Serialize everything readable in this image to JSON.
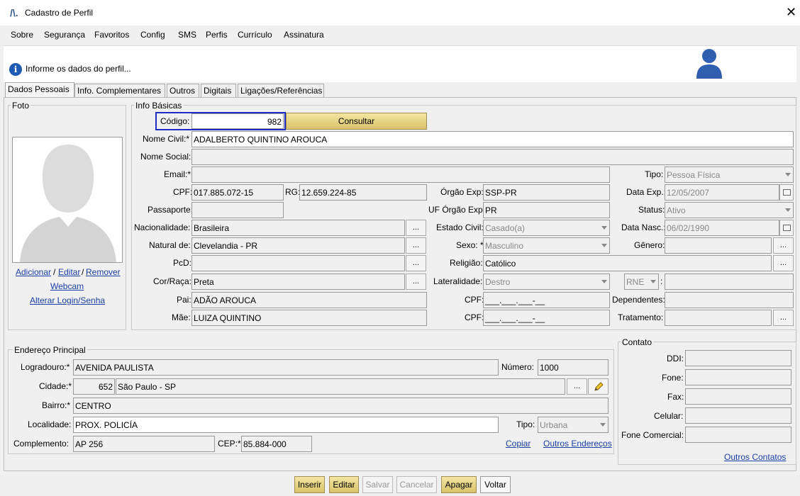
{
  "window": {
    "title": "Cadastro de Perfil",
    "close": "✕",
    "logo": "/\\."
  },
  "menu": [
    "Sobre",
    "Segurança",
    "Favoritos",
    "Config",
    "SMS",
    "Perfis",
    "Currículo",
    "Assinatura"
  ],
  "info": {
    "text": "Informe os dados do perfil...",
    "icon": "i"
  },
  "tabs": [
    "Dados Pessoais",
    "Info. Complementares",
    "Outros",
    "Digitais",
    "Ligações/Referências"
  ],
  "foto": {
    "legend": "Foto",
    "adicionar": "Adicionar",
    "sep1": "/",
    "editar": "Editar",
    "sep2": "/",
    "remover": "Remover",
    "webcam": "Webcam",
    "alterar": "Alterar Login/Senha"
  },
  "info_basicas": {
    "legend": "Info Básicas",
    "codigo_label": "Código:",
    "codigo": "982",
    "consultar": "Consultar",
    "nome_civil_label": "Nome Civil:*",
    "nome_civil": "ADALBERTO QUINTINO AROUCA",
    "nome_social_label": "Nome Social:",
    "nome_social": "",
    "email_label": "Email:*",
    "email": "",
    "tipo_label": "Tipo:",
    "tipo": "Pessoa Física",
    "cpf_label": "CPF:",
    "cpf": "017.885.072-15",
    "rg_label": "RG:",
    "rg": "12.659.224-85",
    "orgao_exp_label": "Órgão Exp:",
    "orgao_exp": "SSP-PR",
    "data_exp_label": "Data Exp.:",
    "data_exp": "12/05/2007",
    "passaporte_label": "Passaporte:",
    "passaporte": "",
    "uf_orgao_label": "UF Órgão Exp:",
    "uf_orgao": "PR",
    "status_label": "Status:",
    "status": "Ativo",
    "nacionalidade_label": "Nacionalidade:",
    "nacionalidade": "Brasileira",
    "estado_civil_label": "Estado Civil:",
    "estado_civil": "Casado(a)",
    "data_nasc_label": "Data Nasc.:",
    "data_nasc": "06/02/1990",
    "natural_label": "Natural de:",
    "natural": "Clevelandia - PR",
    "sexo_label": "Sexo: *",
    "sexo": "Masculino",
    "genero_label": "Gênero:",
    "genero": "",
    "pcd_label": "PcD:",
    "pcd": "",
    "religiao_label": "Religião:",
    "religiao": "Católico",
    "cor_label": "Cor/Raça:",
    "cor": "Preta",
    "lateralidade_label": "Lateralidade:",
    "lateralidade": "Destro",
    "rne": "RNE",
    "rne_sep": ":",
    "rne_value": "",
    "pai_label": "Pai:",
    "pai": "ADÃO AROUCA",
    "cpf_pai_label": "CPF:",
    "cpf_pai": "___.___.___-__",
    "dependentes_label": "Dependentes:",
    "dependentes": "",
    "mae_label": "Mãe:",
    "mae": "LUIZA QUINTINO",
    "cpf_mae_label": "CPF:",
    "cpf_mae": "___.___.___-__",
    "tratamento_label": "Tratamento:",
    "tratamento": "",
    "dots": "..."
  },
  "endereco": {
    "legend": "Endereço Principal",
    "logradouro_label": "Logradouro:*",
    "logradouro": "AVENIDA PAULISTA",
    "numero_label": "Número:",
    "numero": "1000",
    "cidade_label": "Cidade:*",
    "cidade_cod": "652",
    "cidade": "São Paulo - SP",
    "bairro_label": "Bairro:*",
    "bairro": "CENTRO",
    "localidade_label": "Localidade:",
    "localidade": "PROX. POLICÍA",
    "tipo_label": "Tipo:",
    "tipo": "Urbana",
    "complemento_label": "Complemento:",
    "complemento": "AP 256",
    "cep_label": "CEP:*",
    "cep": "85.884-000",
    "copiar": "Copiar",
    "outros": "Outros Endereços"
  },
  "contato": {
    "legend": "Contato",
    "ddi_label": "DDI:",
    "fone_label": "Fone:",
    "fax_label": "Fax:",
    "celular_label": "Celular:",
    "fone_com_label": "Fone Comercial:",
    "outros": "Outros Contatos"
  },
  "buttons": {
    "inserir": "Inserir",
    "editar": "Editar",
    "salvar": "Salvar",
    "cancelar": "Cancelar",
    "apagar": "Apagar",
    "voltar": "Voltar"
  }
}
